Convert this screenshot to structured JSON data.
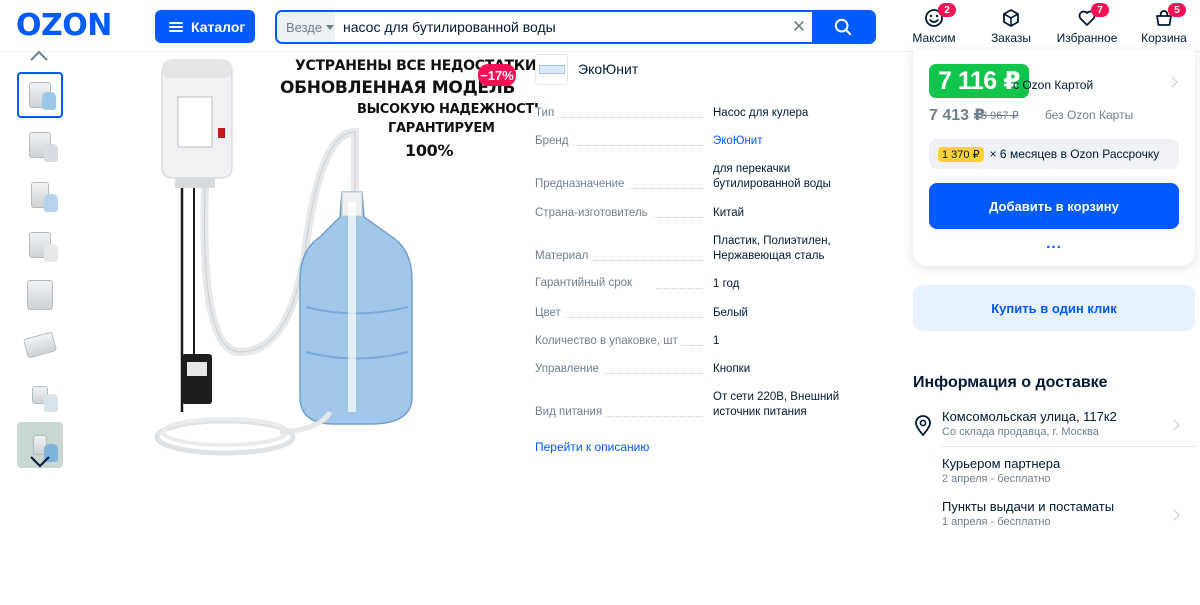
{
  "header": {
    "logo": "OZON",
    "catalog_label": "Каталог",
    "search": {
      "scope": "Везде",
      "value": "насос для бутилированной воды"
    },
    "nav": [
      {
        "label": "Максим",
        "badge": "2",
        "icon": "face-icon"
      },
      {
        "label": "Заказы",
        "badge": "",
        "icon": "box-icon"
      },
      {
        "label": "Избранное",
        "badge": "7",
        "icon": "heart-icon"
      },
      {
        "label": "Корзина",
        "badge": "5",
        "icon": "cart-icon"
      }
    ]
  },
  "gallery": {
    "thumb_count": 8,
    "active_index": 0
  },
  "promo": {
    "line1": "УСТРАНЕНЫ ВСЕ НЕДОСТАТКИ",
    "line2": "ОБНОВЛЕННАЯ МОДЕЛЬ",
    "line3": "ВЫСОКУЮ НАДЕЖНОСТЬ",
    "line4": "ГАРАНТИРУЕМ",
    "line5": "100%",
    "discount": "−17%"
  },
  "seller": {
    "name": "ЭкоЮнит"
  },
  "specs": [
    {
      "key": "Тип",
      "value": "Насос для кулера"
    },
    {
      "key": "Бренд",
      "value": "ЭкоЮнит",
      "link": true
    },
    {
      "key": "Предназначение",
      "value": "для перекачки бутилированной воды"
    },
    {
      "key": "Страна-изготовитель",
      "value": "Китай"
    },
    {
      "key": "Материал",
      "value": "Пластик, Полиэтилен, Нержавеющая сталь"
    },
    {
      "key": "Гарантийный срок",
      "value": "1 год",
      "info": true
    },
    {
      "key": "Цвет",
      "value": "Белый"
    },
    {
      "key": "Количество в упаковке, шт",
      "value": "1"
    },
    {
      "key": "Управление",
      "value": "Кнопки"
    },
    {
      "key": "Вид питания",
      "value": "От сети 220В, Внешний источник питания"
    }
  ],
  "goto_description": "Перейти к описанию",
  "price": {
    "card_price": "7 116 ₽",
    "card_note": "с Ozon Картой",
    "regular_price": "7 413 ₽",
    "old_price": "8 967 ₽",
    "regular_note": "без Ozon Карты",
    "installment_amount": "1 370 ₽",
    "installment_note": "× 6 месяцев в Ozon Рассрочку",
    "add_to_cart": "Добавить в корзину",
    "more": "..."
  },
  "one_click": "Купить в один клик",
  "delivery": {
    "title": "Информация о доставке",
    "items": [
      {
        "main": "Комсомольская улица, 117к2",
        "sub": "Со склада продавца, г. Москва"
      },
      {
        "main": "Курьером партнера",
        "sub": "2 апреля - бесплатно"
      },
      {
        "main": "Пункты выдачи и постаматы",
        "sub": "1 апреля - бесплатно"
      }
    ]
  },
  "colors": {
    "accent": "#005bff",
    "price_green": "#10c44c",
    "badge": "#f91155",
    "installment_yellow": "#ffd231"
  }
}
